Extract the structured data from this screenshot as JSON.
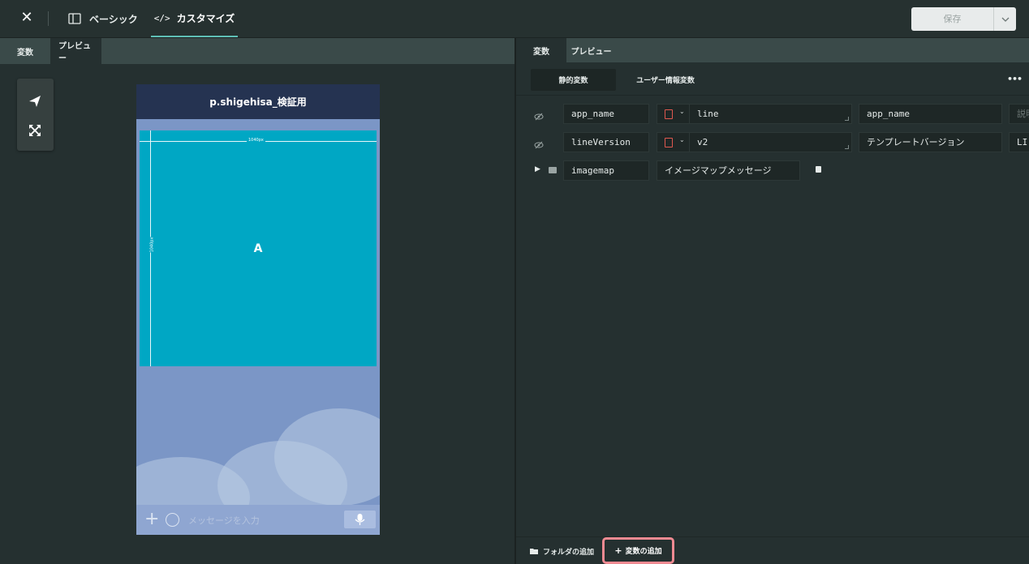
{
  "topbar": {
    "close_icon": "close-icon",
    "tab_basic": "ベーシック",
    "tab_custom": "カスタマイズ",
    "tab_custom_icon": "</>",
    "save_label": "保存",
    "accent_color": "#5fbfb6"
  },
  "left": {
    "subtabs": [
      "変数",
      "プレビュー"
    ],
    "active_subtab": "プレビュー",
    "tools": [
      "send-icon",
      "expand-icon"
    ],
    "phone": {
      "title": "p.shigehisa_検証用",
      "imagemap_label": "A",
      "width_label": "1040px",
      "height_label": "1040px",
      "input_placeholder": "メッセージを入力",
      "imagemap_color": "#00a7c4"
    }
  },
  "right": {
    "subtabs": [
      "変数",
      "プレビュー"
    ],
    "active_subtab": "変数",
    "segments": [
      "静的変数",
      "ユーザー情報変数"
    ],
    "active_segment": "静的変数",
    "rows": [
      {
        "name": "app_name",
        "value": "line",
        "description": "app_name",
        "extra": "説明"
      },
      {
        "name": "lineVersion",
        "value": "v2",
        "description": "テンプレートバージョン",
        "extra": "LI"
      }
    ],
    "folder_row": {
      "name": "imagemap",
      "description": "イメージマップメッセージ"
    },
    "add_folder_label": "フォルダの追加",
    "add_variable_label": "変数の追加",
    "highlight_color": "#f08a92"
  }
}
